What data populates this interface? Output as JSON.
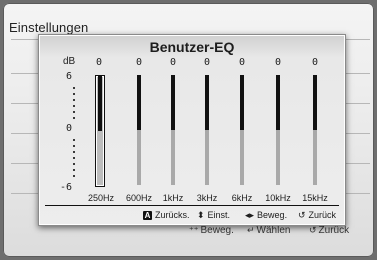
{
  "background": {
    "title": "Einstellungen",
    "bottom_bar": [
      {
        "icon": "move-arrows-icon",
        "glyph": "⁺⁺",
        "label": "Beweg."
      },
      {
        "icon": "enter-icon",
        "glyph": "↵",
        "label": "Wählen"
      },
      {
        "icon": "return-icon",
        "glyph": "↺",
        "label": "Zurück"
      }
    ]
  },
  "dialog": {
    "title": "Benutzer-EQ",
    "unit": "dB",
    "scale": {
      "top": "6",
      "middle": "0",
      "bottom": "-6"
    },
    "bands": [
      {
        "freq": "250Hz",
        "value": "0",
        "level": 0,
        "selected": true
      },
      {
        "freq": "600Hz",
        "value": "0",
        "level": 0,
        "selected": false
      },
      {
        "freq": "1kHz",
        "value": "0",
        "level": 0,
        "selected": false
      },
      {
        "freq": "3kHz",
        "value": "0",
        "level": 0,
        "selected": false
      },
      {
        "freq": "6kHz",
        "value": "0",
        "level": 0,
        "selected": false
      },
      {
        "freq": "10kHz",
        "value": "0",
        "level": 0,
        "selected": false
      },
      {
        "freq": "15kHz",
        "value": "0",
        "level": 0,
        "selected": false
      }
    ],
    "footer": [
      {
        "icon": "a-button-icon",
        "glyph": "A",
        "label": "Zurücks."
      },
      {
        "icon": "up-down-arrows-icon",
        "glyph": "⬍",
        "label": "Einst."
      },
      {
        "icon": "left-right-arrows-icon",
        "glyph": "◂▸",
        "label": "Beweg."
      },
      {
        "icon": "return-icon",
        "glyph": "↺",
        "label": "Zurück"
      }
    ]
  }
}
